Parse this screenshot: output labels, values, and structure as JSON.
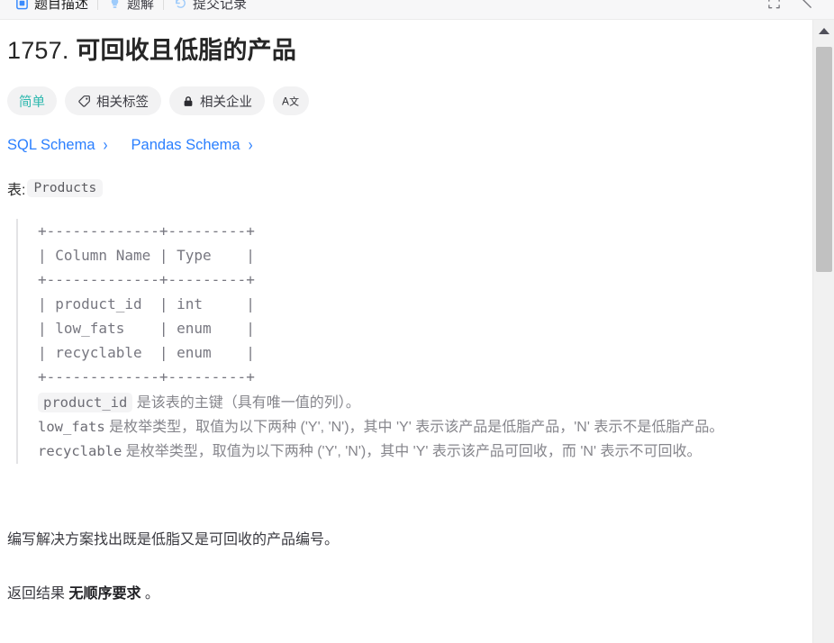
{
  "header": {
    "tabs": [
      {
        "label": "题目描述",
        "icon": "document-icon",
        "active": true
      },
      {
        "label": "题解",
        "icon": "lightbulb-icon",
        "active": false
      },
      {
        "label": "提交记录",
        "icon": "history-icon",
        "active": false
      }
    ],
    "actions": [
      {
        "name": "expand-icon",
        "label": "全屏"
      },
      {
        "name": "collapse-diagonal-icon",
        "label": "收起"
      }
    ]
  },
  "problem": {
    "number": "1757.",
    "title": "可回收且低脂的产品",
    "badges": [
      {
        "label": "简单",
        "icon": null,
        "style": "difficulty"
      },
      {
        "label": "相关标签",
        "icon": "tag-icon",
        "style": "normal"
      },
      {
        "label": "相关企业",
        "icon": "lock-icon",
        "style": "normal"
      },
      {
        "label": "A文",
        "icon": "translate-icon",
        "style": "square"
      }
    ],
    "schema_links": [
      {
        "label": "SQL Schema",
        "chevron": "›"
      },
      {
        "label": "Pandas Schema",
        "chevron": "›"
      }
    ],
    "table_label_prefix": "表:",
    "table_name": "Products",
    "ascii_table": "+-------------+---------+\n| Column Name | Type    |\n+-------------+---------+\n| product_id  | int     |\n| low_fats    | enum    |\n| recyclable  | enum    |\n+-------------+---------+",
    "columns": [
      {
        "name": "product_id",
        "type": "int"
      },
      {
        "name": "low_fats",
        "type": "enum"
      },
      {
        "name": "recyclable",
        "type": "enum"
      }
    ],
    "notes": [
      {
        "code": "product_id",
        "boxed": true,
        "text": " 是该表的主键（具有唯一值的列）。"
      },
      {
        "code": "low_fats",
        "boxed": false,
        "text": " 是枚举类型，取值为以下两种 ('Y', 'N')，其中 'Y' 表示该产品是低脂产品，'N' 表示不是低脂产品。"
      },
      {
        "code": "recyclable",
        "boxed": false,
        "text": " 是枚举类型，取值为以下两种 ('Y', 'N')，其中 'Y' 表示该产品可回收，而 'N' 表示不可回收。"
      }
    ],
    "statement": "编写解决方案找出既是低脂又是可回收的产品编号。",
    "order_note_prefix": "返回结果 ",
    "order_note_bold": "无顺序要求",
    "order_note_suffix": " 。"
  },
  "scrollbar": {
    "up_arrow": "▲",
    "thumb_position": "top"
  },
  "colors": {
    "link": "#2a7fff",
    "difficulty": "#2db8ae",
    "body": "#3a3a40",
    "muted": "#86868c"
  }
}
